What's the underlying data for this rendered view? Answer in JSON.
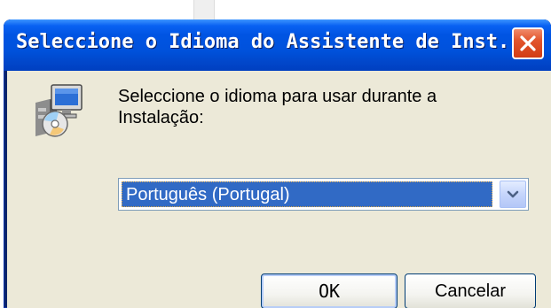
{
  "dialog": {
    "title": "Seleccione o Idioma do Assistente de Inst...",
    "prompt_line1": "Seleccione o idioma para usar durante a",
    "prompt_line2": "Instalação:",
    "language_select": {
      "selected": "Português (Portugal)"
    },
    "buttons": {
      "ok": "OK",
      "cancel": "Cancelar"
    }
  },
  "icons": {
    "setup": "setup-computer-cd-icon",
    "close": "close-icon",
    "dropdown": "chevron-down-icon"
  },
  "colors": {
    "titlebar": "#0054e3",
    "client_bg": "#ece9d8",
    "selection": "#316ac5",
    "close": "#d23c14"
  }
}
